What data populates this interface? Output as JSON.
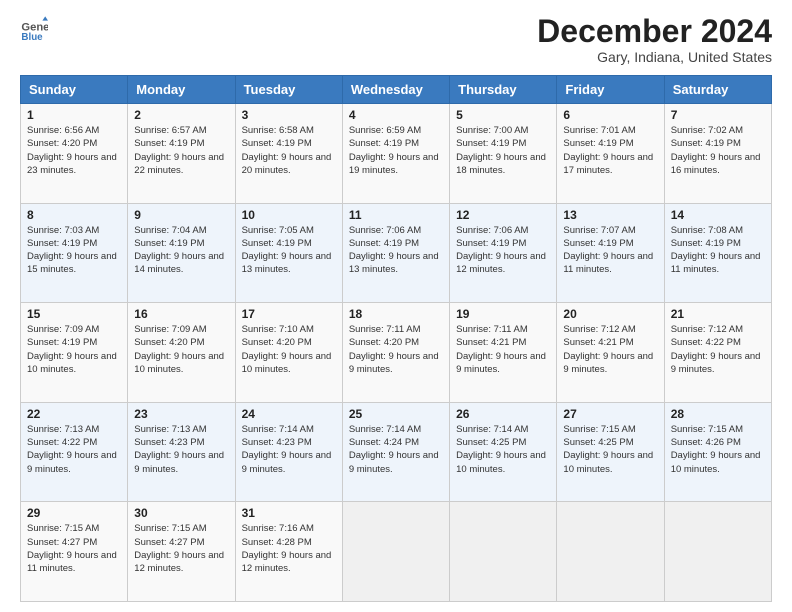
{
  "header": {
    "logo_line1": "General",
    "logo_line2": "Blue",
    "month_title": "December 2024",
    "location": "Gary, Indiana, United States"
  },
  "weekdays": [
    "Sunday",
    "Monday",
    "Tuesday",
    "Wednesday",
    "Thursday",
    "Friday",
    "Saturday"
  ],
  "weeks": [
    [
      {
        "day": "1",
        "sunrise": "Sunrise: 6:56 AM",
        "sunset": "Sunset: 4:20 PM",
        "daylight": "Daylight: 9 hours and 23 minutes."
      },
      {
        "day": "2",
        "sunrise": "Sunrise: 6:57 AM",
        "sunset": "Sunset: 4:19 PM",
        "daylight": "Daylight: 9 hours and 22 minutes."
      },
      {
        "day": "3",
        "sunrise": "Sunrise: 6:58 AM",
        "sunset": "Sunset: 4:19 PM",
        "daylight": "Daylight: 9 hours and 20 minutes."
      },
      {
        "day": "4",
        "sunrise": "Sunrise: 6:59 AM",
        "sunset": "Sunset: 4:19 PM",
        "daylight": "Daylight: 9 hours and 19 minutes."
      },
      {
        "day": "5",
        "sunrise": "Sunrise: 7:00 AM",
        "sunset": "Sunset: 4:19 PM",
        "daylight": "Daylight: 9 hours and 18 minutes."
      },
      {
        "day": "6",
        "sunrise": "Sunrise: 7:01 AM",
        "sunset": "Sunset: 4:19 PM",
        "daylight": "Daylight: 9 hours and 17 minutes."
      },
      {
        "day": "7",
        "sunrise": "Sunrise: 7:02 AM",
        "sunset": "Sunset: 4:19 PM",
        "daylight": "Daylight: 9 hours and 16 minutes."
      }
    ],
    [
      {
        "day": "8",
        "sunrise": "Sunrise: 7:03 AM",
        "sunset": "Sunset: 4:19 PM",
        "daylight": "Daylight: 9 hours and 15 minutes."
      },
      {
        "day": "9",
        "sunrise": "Sunrise: 7:04 AM",
        "sunset": "Sunset: 4:19 PM",
        "daylight": "Daylight: 9 hours and 14 minutes."
      },
      {
        "day": "10",
        "sunrise": "Sunrise: 7:05 AM",
        "sunset": "Sunset: 4:19 PM",
        "daylight": "Daylight: 9 hours and 13 minutes."
      },
      {
        "day": "11",
        "sunrise": "Sunrise: 7:06 AM",
        "sunset": "Sunset: 4:19 PM",
        "daylight": "Daylight: 9 hours and 13 minutes."
      },
      {
        "day": "12",
        "sunrise": "Sunrise: 7:06 AM",
        "sunset": "Sunset: 4:19 PM",
        "daylight": "Daylight: 9 hours and 12 minutes."
      },
      {
        "day": "13",
        "sunrise": "Sunrise: 7:07 AM",
        "sunset": "Sunset: 4:19 PM",
        "daylight": "Daylight: 9 hours and 11 minutes."
      },
      {
        "day": "14",
        "sunrise": "Sunrise: 7:08 AM",
        "sunset": "Sunset: 4:19 PM",
        "daylight": "Daylight: 9 hours and 11 minutes."
      }
    ],
    [
      {
        "day": "15",
        "sunrise": "Sunrise: 7:09 AM",
        "sunset": "Sunset: 4:19 PM",
        "daylight": "Daylight: 9 hours and 10 minutes."
      },
      {
        "day": "16",
        "sunrise": "Sunrise: 7:09 AM",
        "sunset": "Sunset: 4:20 PM",
        "daylight": "Daylight: 9 hours and 10 minutes."
      },
      {
        "day": "17",
        "sunrise": "Sunrise: 7:10 AM",
        "sunset": "Sunset: 4:20 PM",
        "daylight": "Daylight: 9 hours and 10 minutes."
      },
      {
        "day": "18",
        "sunrise": "Sunrise: 7:11 AM",
        "sunset": "Sunset: 4:20 PM",
        "daylight": "Daylight: 9 hours and 9 minutes."
      },
      {
        "day": "19",
        "sunrise": "Sunrise: 7:11 AM",
        "sunset": "Sunset: 4:21 PM",
        "daylight": "Daylight: 9 hours and 9 minutes."
      },
      {
        "day": "20",
        "sunrise": "Sunrise: 7:12 AM",
        "sunset": "Sunset: 4:21 PM",
        "daylight": "Daylight: 9 hours and 9 minutes."
      },
      {
        "day": "21",
        "sunrise": "Sunrise: 7:12 AM",
        "sunset": "Sunset: 4:22 PM",
        "daylight": "Daylight: 9 hours and 9 minutes."
      }
    ],
    [
      {
        "day": "22",
        "sunrise": "Sunrise: 7:13 AM",
        "sunset": "Sunset: 4:22 PM",
        "daylight": "Daylight: 9 hours and 9 minutes."
      },
      {
        "day": "23",
        "sunrise": "Sunrise: 7:13 AM",
        "sunset": "Sunset: 4:23 PM",
        "daylight": "Daylight: 9 hours and 9 minutes."
      },
      {
        "day": "24",
        "sunrise": "Sunrise: 7:14 AM",
        "sunset": "Sunset: 4:23 PM",
        "daylight": "Daylight: 9 hours and 9 minutes."
      },
      {
        "day": "25",
        "sunrise": "Sunrise: 7:14 AM",
        "sunset": "Sunset: 4:24 PM",
        "daylight": "Daylight: 9 hours and 9 minutes."
      },
      {
        "day": "26",
        "sunrise": "Sunrise: 7:14 AM",
        "sunset": "Sunset: 4:25 PM",
        "daylight": "Daylight: 9 hours and 10 minutes."
      },
      {
        "day": "27",
        "sunrise": "Sunrise: 7:15 AM",
        "sunset": "Sunset: 4:25 PM",
        "daylight": "Daylight: 9 hours and 10 minutes."
      },
      {
        "day": "28",
        "sunrise": "Sunrise: 7:15 AM",
        "sunset": "Sunset: 4:26 PM",
        "daylight": "Daylight: 9 hours and 10 minutes."
      }
    ],
    [
      {
        "day": "29",
        "sunrise": "Sunrise: 7:15 AM",
        "sunset": "Sunset: 4:27 PM",
        "daylight": "Daylight: 9 hours and 11 minutes."
      },
      {
        "day": "30",
        "sunrise": "Sunrise: 7:15 AM",
        "sunset": "Sunset: 4:27 PM",
        "daylight": "Daylight: 9 hours and 12 minutes."
      },
      {
        "day": "31",
        "sunrise": "Sunrise: 7:16 AM",
        "sunset": "Sunset: 4:28 PM",
        "daylight": "Daylight: 9 hours and 12 minutes."
      },
      null,
      null,
      null,
      null
    ]
  ]
}
